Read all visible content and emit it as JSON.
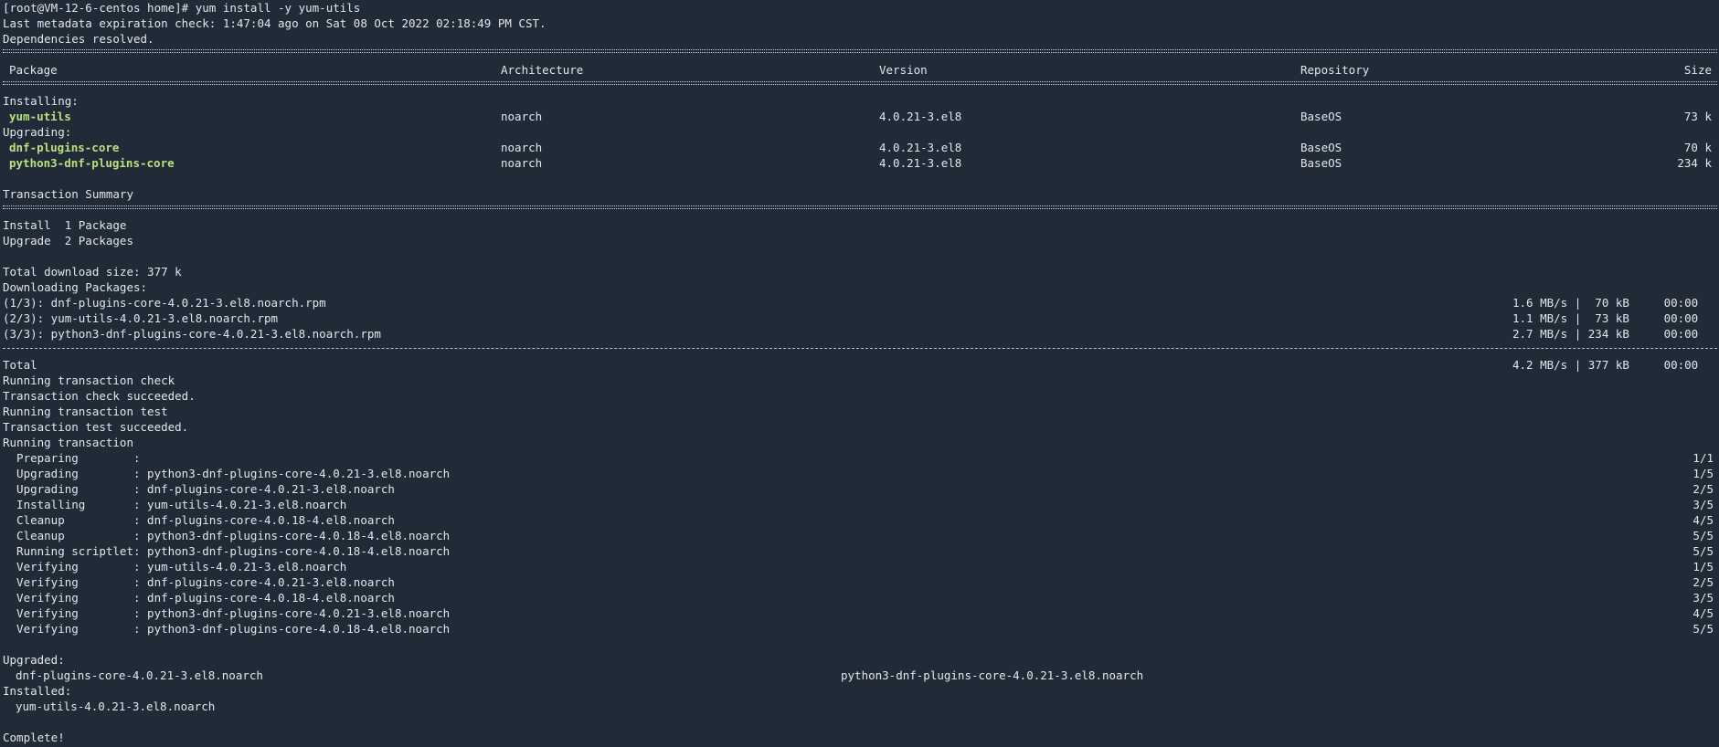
{
  "terminal": {
    "prompt_line": "[root@VM-12-6-centos home]# yum install -y yum-utils",
    "metadata_line": "Last metadata expiration check: 1:47:04 ago on Sat 08 Oct 2022 02:18:49 PM CST.",
    "deps_line": "Dependencies resolved.",
    "table_headers": {
      "package": "Package",
      "architecture": "Architecture",
      "version": "Version",
      "repository": "Repository",
      "size": "Size"
    },
    "installing_label": "Installing:",
    "upgrading_label": "Upgrading:",
    "packages": [
      {
        "name": "yum-utils",
        "arch": "noarch",
        "version": "4.0.21-3.el8",
        "repo": "BaseOS",
        "size": "73 k"
      },
      {
        "name": "dnf-plugins-core",
        "arch": "noarch",
        "version": "4.0.21-3.el8",
        "repo": "BaseOS",
        "size": "70 k"
      },
      {
        "name": "python3-dnf-plugins-core",
        "arch": "noarch",
        "version": "4.0.21-3.el8",
        "repo": "BaseOS",
        "size": "234 k"
      }
    ],
    "transaction_summary_label": "Transaction Summary",
    "install_summary": "Install  1 Package",
    "upgrade_summary": "Upgrade  2 Packages",
    "total_download_size": "Total download size: 377 k",
    "downloading_label": "Downloading Packages:",
    "downloads": [
      {
        "name": "(1/3): dnf-plugins-core-4.0.21-3.el8.noarch.rpm",
        "stats": "1.6 MB/s |  70 kB     00:00"
      },
      {
        "name": "(2/3): yum-utils-4.0.21-3.el8.noarch.rpm",
        "stats": "1.1 MB/s |  73 kB     00:00"
      },
      {
        "name": "(3/3): python3-dnf-plugins-core-4.0.21-3.el8.noarch.rpm",
        "stats": "2.7 MB/s | 234 kB     00:00"
      }
    ],
    "total_label": "Total",
    "total_stats": "4.2 MB/s | 377 kB     00:00",
    "status_lines": [
      "Running transaction check",
      "Transaction check succeeded.",
      "Running transaction test",
      "Transaction test succeeded.",
      "Running transaction"
    ],
    "steps": [
      {
        "text": "  Preparing        :",
        "count": "1/1"
      },
      {
        "text": "  Upgrading        : python3-dnf-plugins-core-4.0.21-3.el8.noarch",
        "count": "1/5"
      },
      {
        "text": "  Upgrading        : dnf-plugins-core-4.0.21-3.el8.noarch",
        "count": "2/5"
      },
      {
        "text": "  Installing       : yum-utils-4.0.21-3.el8.noarch",
        "count": "3/5"
      },
      {
        "text": "  Cleanup          : dnf-plugins-core-4.0.18-4.el8.noarch",
        "count": "4/5"
      },
      {
        "text": "  Cleanup          : python3-dnf-plugins-core-4.0.18-4.el8.noarch",
        "count": "5/5"
      },
      {
        "text": "  Running scriptlet: python3-dnf-plugins-core-4.0.18-4.el8.noarch",
        "count": "5/5"
      },
      {
        "text": "  Verifying        : yum-utils-4.0.21-3.el8.noarch",
        "count": "1/5"
      },
      {
        "text": "  Verifying        : dnf-plugins-core-4.0.21-3.el8.noarch",
        "count": "2/5"
      },
      {
        "text": "  Verifying        : dnf-plugins-core-4.0.18-4.el8.noarch",
        "count": "3/5"
      },
      {
        "text": "  Verifying        : python3-dnf-plugins-core-4.0.21-3.el8.noarch",
        "count": "4/5"
      },
      {
        "text": "  Verifying        : python3-dnf-plugins-core-4.0.18-4.el8.noarch",
        "count": "5/5"
      }
    ],
    "upgraded_label": "Upgraded:",
    "upgraded_items": [
      "dnf-plugins-core-4.0.21-3.el8.noarch",
      "python3-dnf-plugins-core-4.0.21-3.el8.noarch"
    ],
    "installed_label": "Installed:",
    "installed_items": [
      "yum-utils-4.0.21-3.el8.noarch"
    ],
    "complete_line": "Complete!"
  },
  "colors": {
    "background": "#202b37",
    "text": "#e3e6ea",
    "package_name": "#b9e080"
  }
}
